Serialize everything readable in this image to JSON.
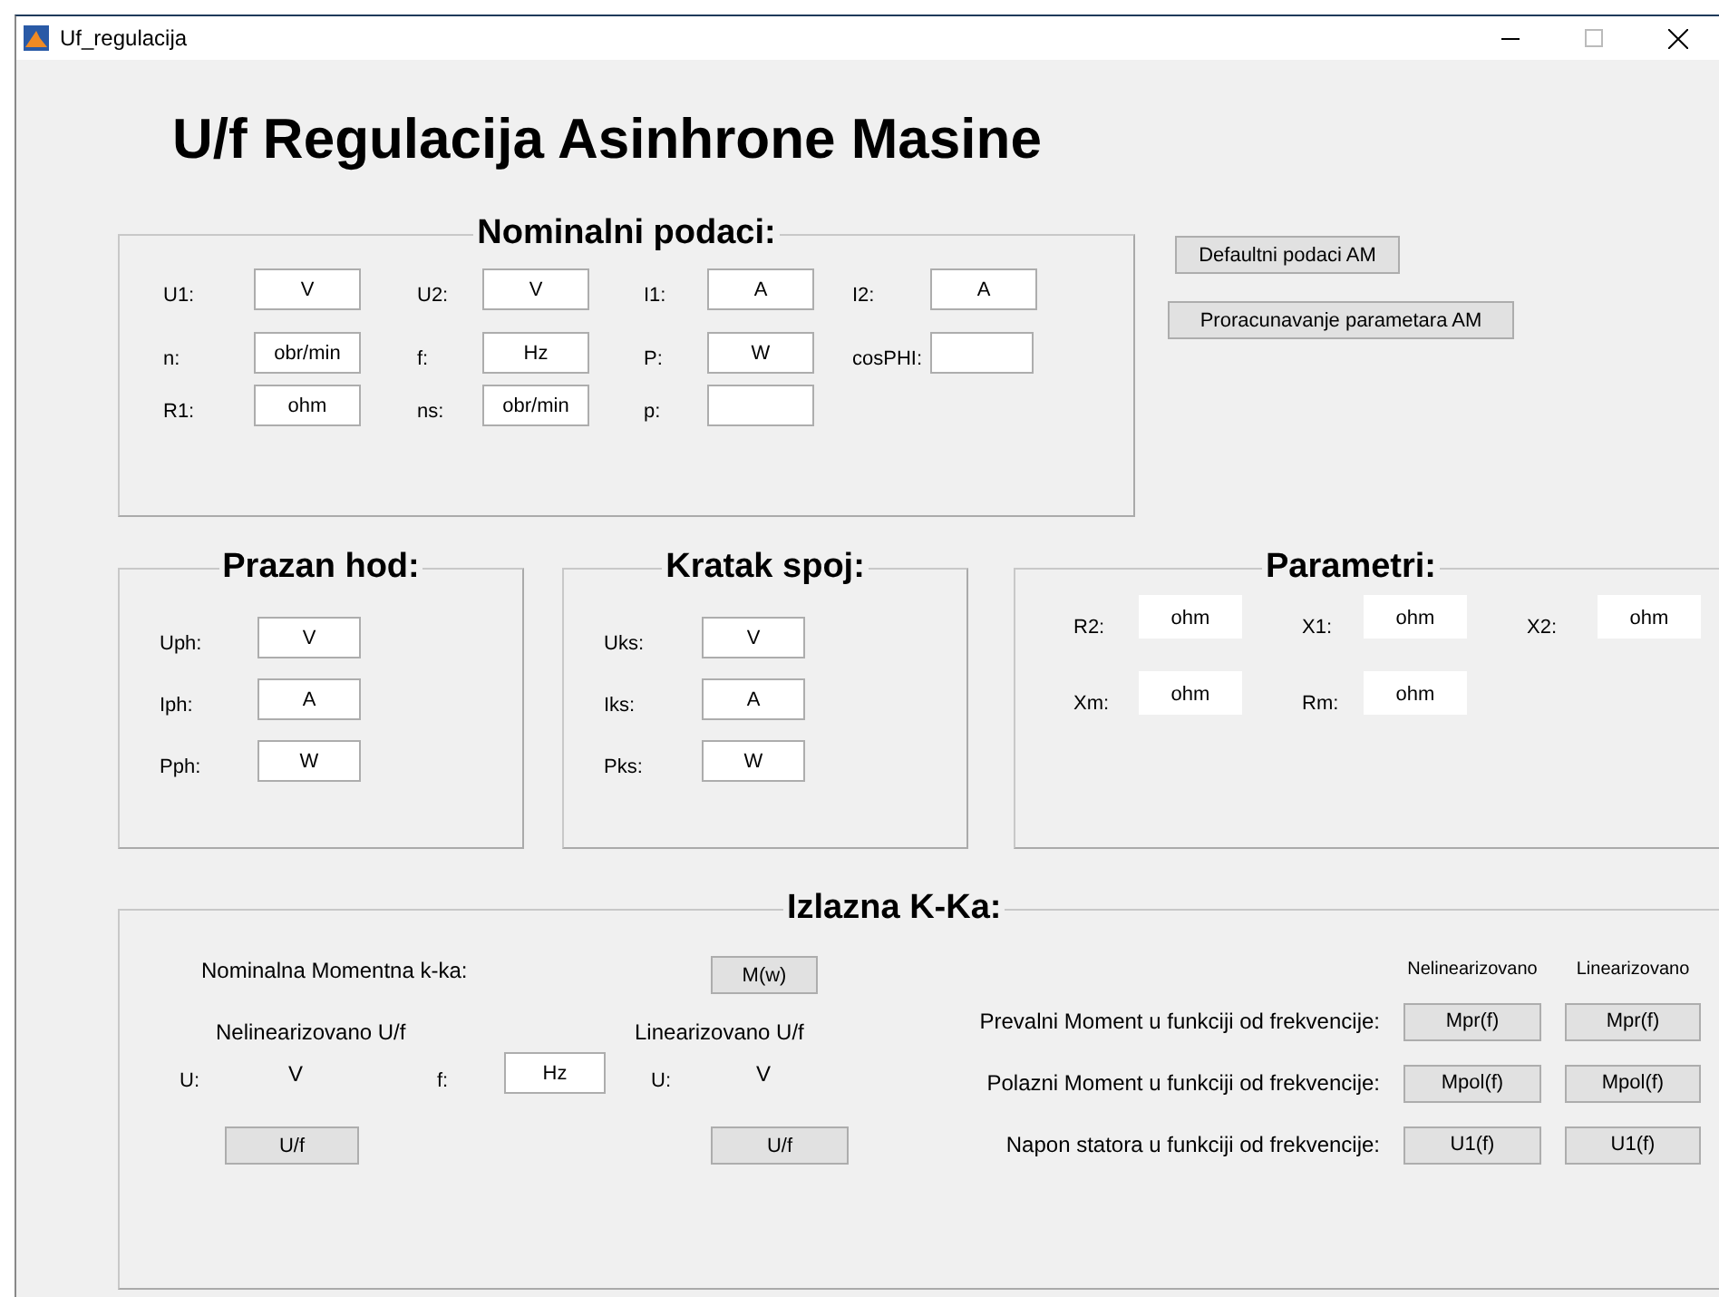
{
  "window": {
    "title": "Uf_regulacija"
  },
  "heading": "U/f Regulacija Asinhrone Masine",
  "nominal": {
    "title": "Nominalni podaci:",
    "rows": [
      [
        {
          "label": "U1:",
          "value": "V"
        },
        {
          "label": "U2:",
          "value": "V"
        },
        {
          "label": "I1:",
          "value": "A"
        },
        {
          "label": "I2:",
          "value": "A"
        }
      ],
      [
        {
          "label": "n:",
          "value": "obr/min"
        },
        {
          "label": "f:",
          "value": "Hz"
        },
        {
          "label": "P:",
          "value": "W"
        },
        {
          "label": "cosPHI:"
        }
      ],
      [
        {
          "label": "R1:",
          "value": "ohm"
        },
        {
          "label": "ns:",
          "value": "obr/min"
        },
        {
          "label": "p:"
        }
      ]
    ]
  },
  "side_buttons": [
    "Defaultni podaci AM",
    "Proracunavanje parametara AM"
  ],
  "no_load": {
    "title": "Prazan hod:",
    "fields": [
      {
        "label": "Uph:",
        "value": "V"
      },
      {
        "label": "Iph:",
        "value": "A"
      },
      {
        "label": "Pph:",
        "value": "W"
      }
    ]
  },
  "short_circuit": {
    "title": "Kratak spoj:",
    "fields": [
      {
        "label": "Uks:",
        "value": "V"
      },
      {
        "label": "Iks:",
        "value": "A"
      },
      {
        "label": "Pks:",
        "value": "W"
      }
    ]
  },
  "parameters": {
    "title": "Parametri:",
    "rows": [
      [
        {
          "label": "R2:",
          "value": "ohm"
        },
        {
          "label": "X1:",
          "value": "ohm"
        },
        {
          "label": "X2:",
          "value": "ohm"
        }
      ],
      [
        {
          "label": "Xm:",
          "value": "ohm"
        },
        {
          "label": "Rm:",
          "value": "ohm"
        }
      ]
    ]
  },
  "output": {
    "title": "Izlazna K-Ka:",
    "nominal_label": "Nominalna Momentna k-ka:",
    "moment_button": "M(w)",
    "nonlinear": {
      "title": "Nelinearizovano U/f",
      "u_label": "U:",
      "u_value": "V",
      "f_label": "f:",
      "f_value": "Hz",
      "button": "U/f"
    },
    "linear": {
      "title": "Linearizovano U/f",
      "u_label": "U:",
      "u_value": "V",
      "button": "U/f"
    },
    "columns": [
      "Nelinearizovano",
      "Linearizovano"
    ],
    "rows": [
      {
        "label": "Prevalni Moment u funkciji od frekvencije:",
        "buttons": [
          "Mpr(f)",
          "Mpr(f)"
        ]
      },
      {
        "label": "Polazni Moment u funkciji od frekvencije:",
        "buttons": [
          "Mpol(f)",
          "Mpol(f)"
        ]
      },
      {
        "label": "Napon statora u funkciji od frekvencije:",
        "buttons": [
          "U1(f)",
          "U1(f)"
        ]
      }
    ]
  }
}
